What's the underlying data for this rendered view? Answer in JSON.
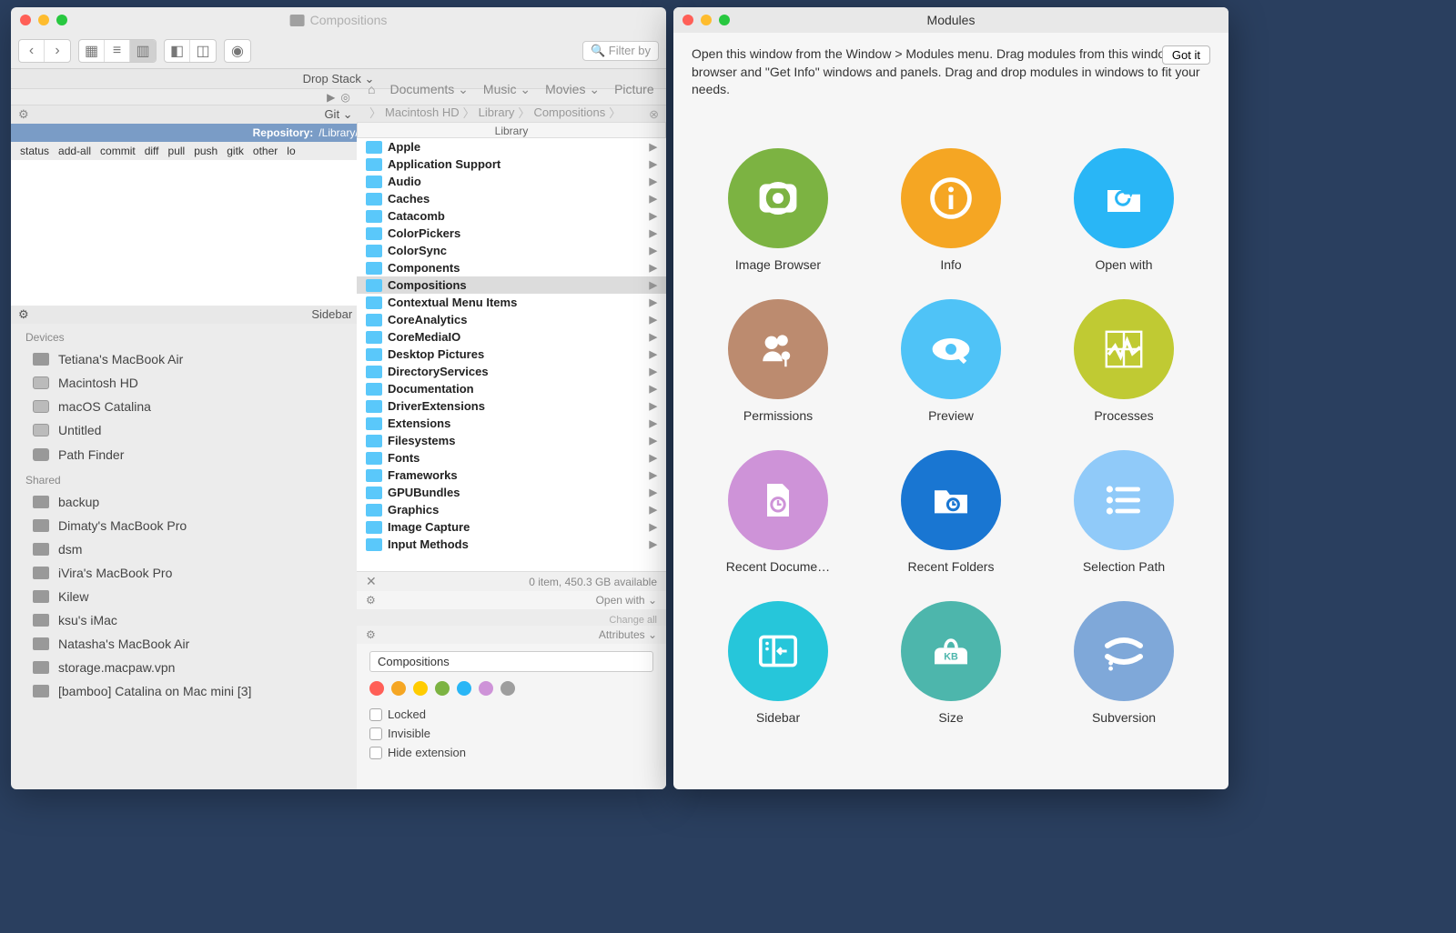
{
  "finder": {
    "title": "Compositions",
    "search_placeholder": "Filter by",
    "drop_stack": "Drop Stack ⌄",
    "git": {
      "header": "Git ⌄",
      "repo_label": "Repository:",
      "repo_path": "/Library/Compositions",
      "commands": [
        "status",
        "add-all",
        "commit",
        "diff",
        "pull",
        "push",
        "gitk",
        "other",
        "lo"
      ]
    },
    "sidebar": {
      "header": "Sidebar ⌄",
      "devices_label": "Devices",
      "shared_label": "Shared",
      "devices": [
        {
          "name": "Tetiana's MacBook Air",
          "type": "laptop"
        },
        {
          "name": "Macintosh HD",
          "type": "disk"
        },
        {
          "name": "macOS Catalina",
          "type": "disk"
        },
        {
          "name": "Untitled",
          "type": "disk"
        },
        {
          "name": "Path Finder",
          "type": "ext",
          "eject": true
        }
      ],
      "shared": [
        {
          "name": "backup"
        },
        {
          "name": "Dimaty's MacBook Pro"
        },
        {
          "name": "dsm"
        },
        {
          "name": "iVira's MacBook Pro"
        },
        {
          "name": "Kilew"
        },
        {
          "name": "ksu's iMac"
        },
        {
          "name": "Natasha's MacBook Air"
        },
        {
          "name": "storage.macpaw.vpn"
        },
        {
          "name": "[bamboo] Catalina on Mac mini [3]"
        }
      ]
    },
    "nav_menus": [
      "Documents ⌄",
      "Music ⌄",
      "Movies ⌄",
      "Picture"
    ],
    "path": [
      "Macintosh HD",
      "Library",
      "Compositions"
    ],
    "column_header": "Library",
    "folders": [
      "Apple",
      "Application Support",
      "Audio",
      "Caches",
      "Catacomb",
      "ColorPickers",
      "ColorSync",
      "Components",
      "Compositions",
      "Contextual Menu Items",
      "CoreAnalytics",
      "CoreMediaIO",
      "Desktop Pictures",
      "DirectoryServices",
      "Documentation",
      "DriverExtensions",
      "Extensions",
      "Filesystems",
      "Fonts",
      "Frameworks",
      "GPUBundles",
      "Graphics",
      "Image Capture",
      "Input Methods"
    ],
    "selected_folder": "Compositions",
    "status": "0 item, 450.3 GB available",
    "openwith": "Open with ⌄",
    "changeall": "Change all",
    "attributes": "Attributes ⌄",
    "attr_name": "Compositions",
    "tag_colors": [
      "#ff5f57",
      "#f5a623",
      "#ffcc00",
      "#7cb342",
      "#29b6f6",
      "#ce93d8",
      "#9e9e9e"
    ],
    "checks": [
      "Locked",
      "Invisible",
      "Hide extension"
    ]
  },
  "modules": {
    "title": "Modules",
    "description": "Open this window from the Window > Modules menu. Drag modules from this window into browser and \"Get Info\" windows and panels. Drag and drop modules in windows to fit your needs.",
    "got_it": "Got it",
    "items": [
      {
        "label": "Image Browser",
        "color": "c-green"
      },
      {
        "label": "Info",
        "color": "c-amber"
      },
      {
        "label": "Open with",
        "color": "c-blue"
      },
      {
        "label": "Permissions",
        "color": "c-brown"
      },
      {
        "label": "Preview",
        "color": "c-lightblue"
      },
      {
        "label": "Processes",
        "color": "c-olive"
      },
      {
        "label": "Recent Docume…",
        "color": "c-pink"
      },
      {
        "label": "Recent Folders",
        "color": "c-darkblue"
      },
      {
        "label": "Selection Path",
        "color": "c-skyblue"
      },
      {
        "label": "Sidebar",
        "color": "c-teal"
      },
      {
        "label": "Size",
        "color": "c-mint"
      },
      {
        "label": "Subversion",
        "color": "c-slateblue"
      }
    ]
  }
}
